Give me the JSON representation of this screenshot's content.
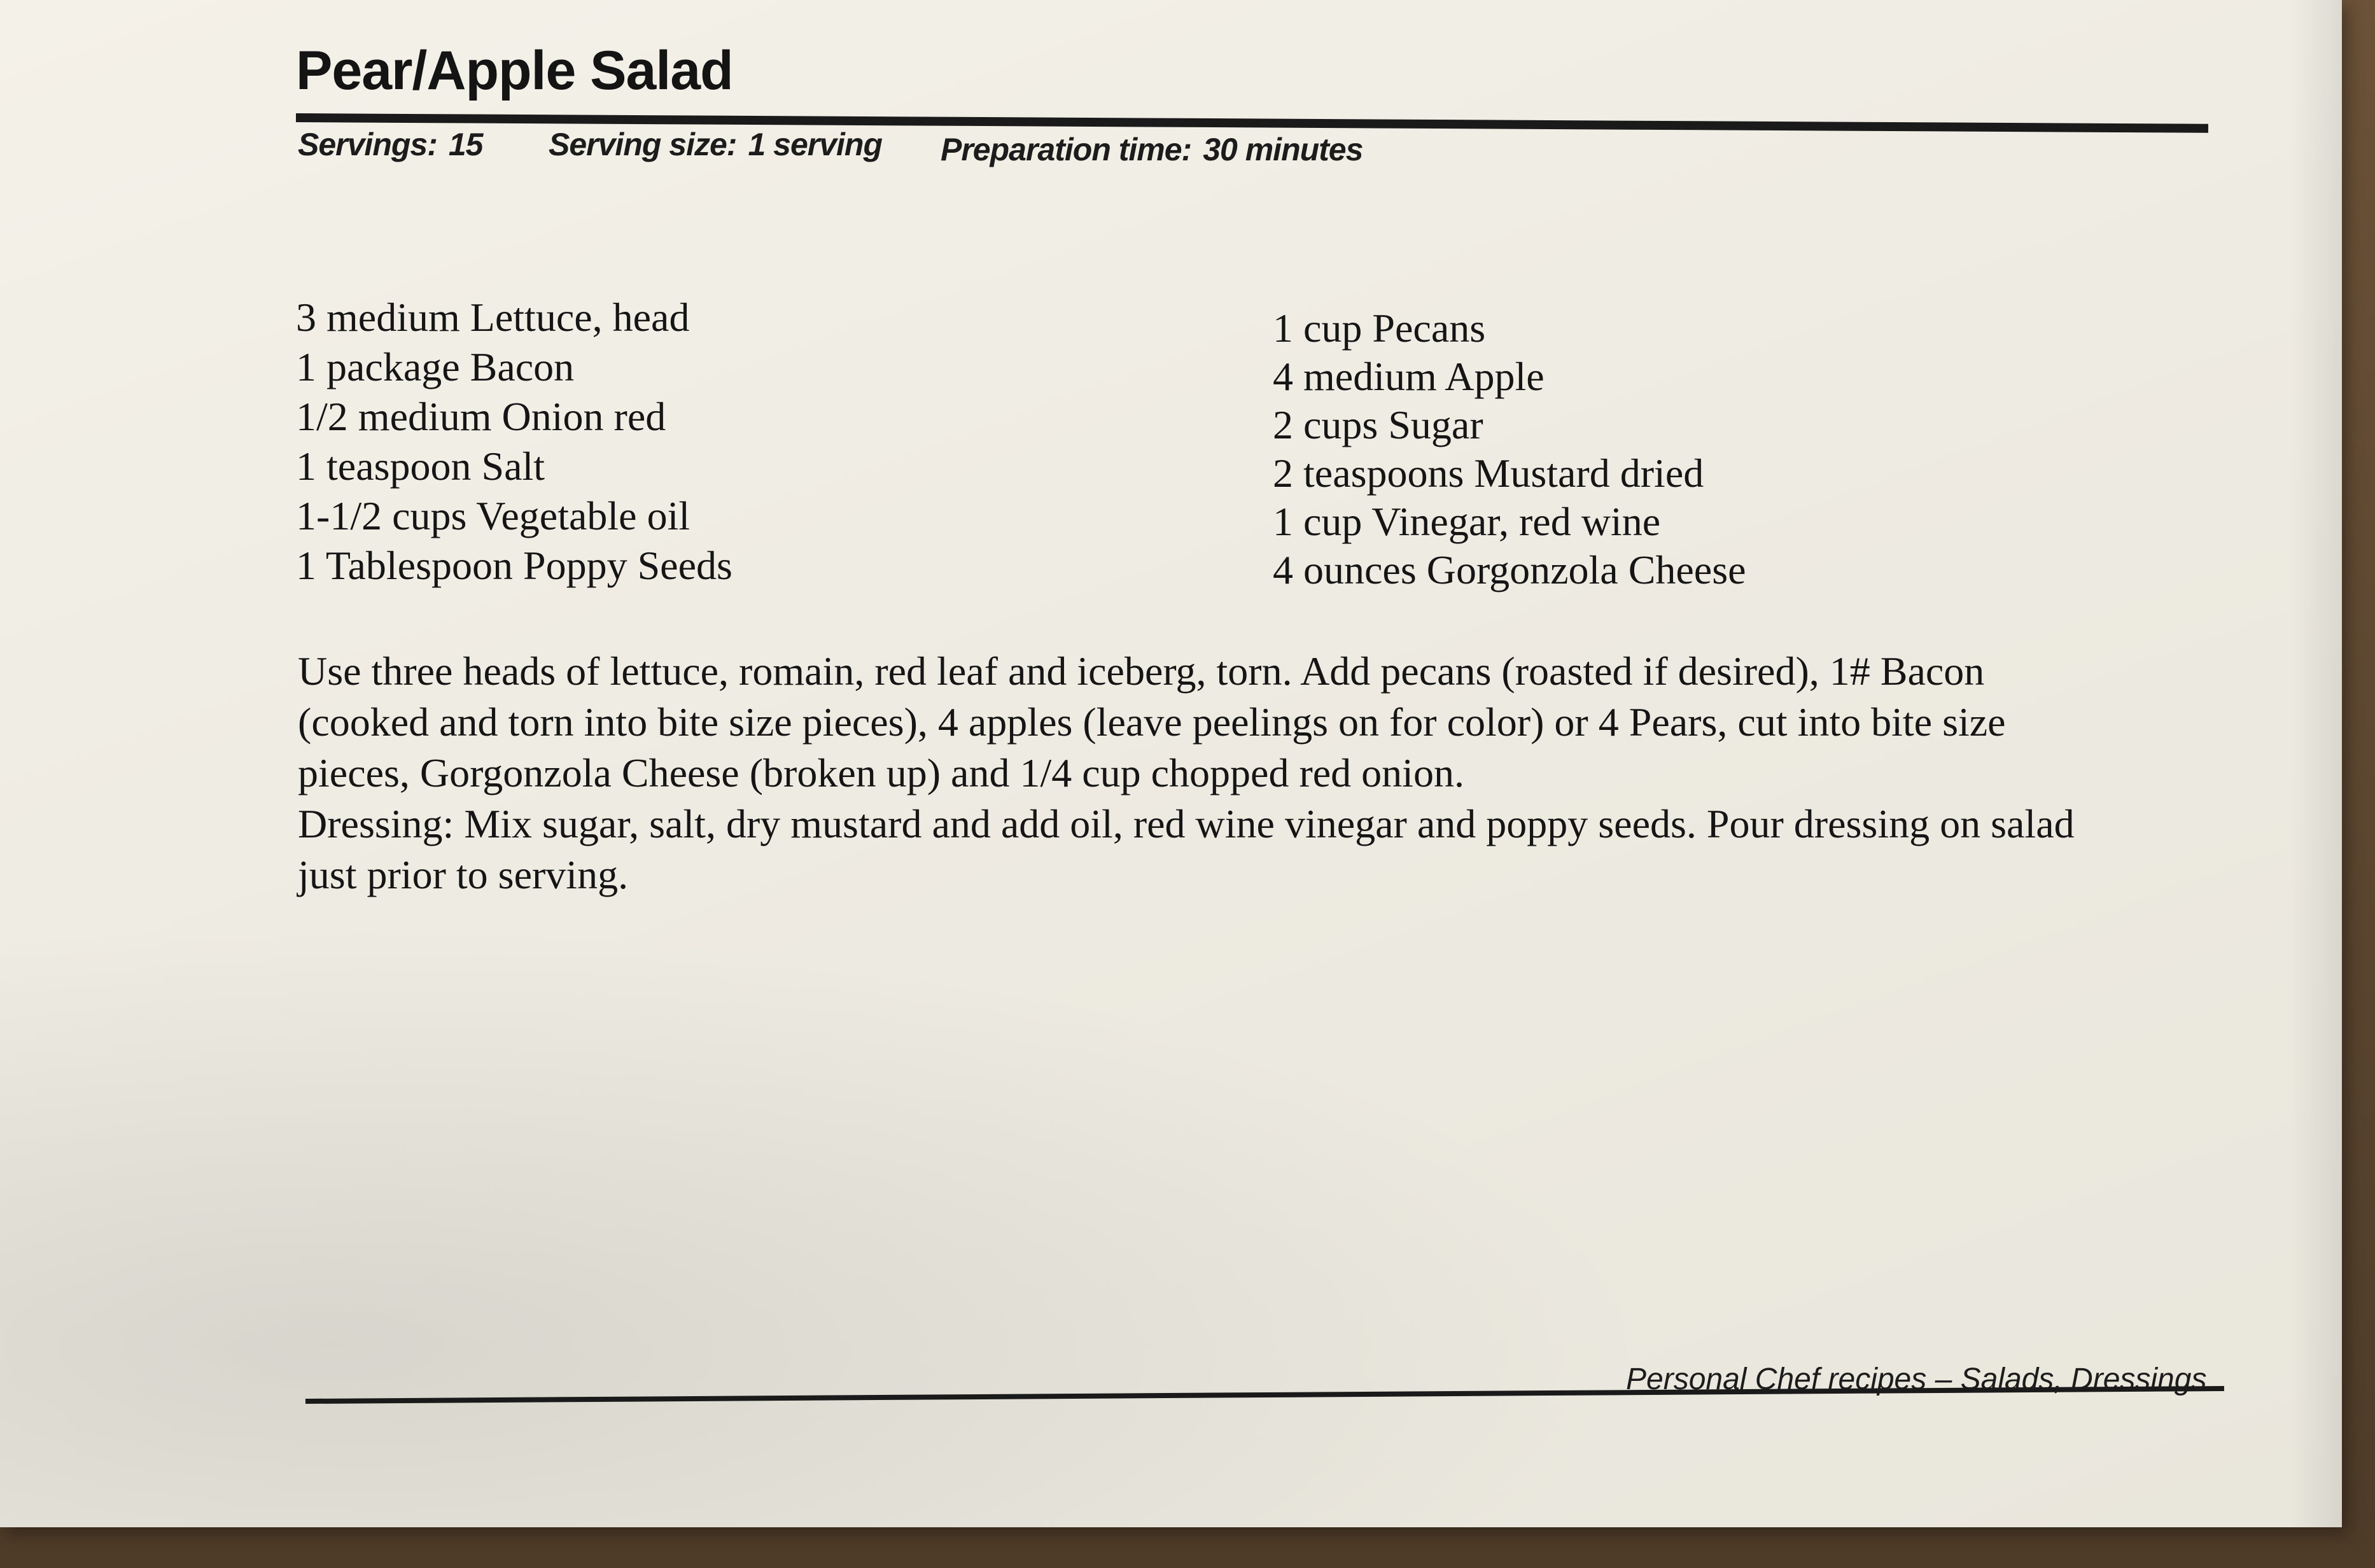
{
  "recipe": {
    "title": "Pear/Apple Salad",
    "servings_label": "Servings:",
    "servings_value": "15",
    "serving_size_label": "Serving size:",
    "serving_size_value": "1 serving",
    "prep_time_label": "Preparation time:",
    "prep_time_value": "30 minutes",
    "ingredients_left": [
      "3 medium Lettuce, head",
      "1 package Bacon",
      "1/2 medium Onion red",
      "1 teaspoon Salt",
      "1-1/2 cups Vegetable oil",
      "1 Tablespoon Poppy Seeds"
    ],
    "ingredients_right": [
      "1 cup Pecans",
      "4 medium Apple",
      "2 cups Sugar",
      "2 teaspoons Mustard dried",
      "1 cup Vinegar, red wine",
      "4 ounces Gorgonzola Cheese"
    ],
    "instructions": [
      "Use three heads of lettuce, romain, red leaf and iceberg, torn.  Add pecans (roasted if desired), 1# Bacon",
      "(cooked and torn into bite size pieces), 4 apples (leave peelings on for color) or 4 Pears, cut into bite size",
      "pieces, Gorgonzola Cheese (broken up) and 1/4 cup chopped red onion.",
      "Dressing:  Mix sugar, salt, dry mustard and add oil, red wine vinegar and poppy seeds.  Pour dressing on salad",
      "just prior to serving."
    ],
    "footer": "Personal Chef recipes – Salads, Dressings"
  },
  "colors": {
    "paper": "#f1eee6",
    "ink": "#151515",
    "background": "#5a4632"
  }
}
